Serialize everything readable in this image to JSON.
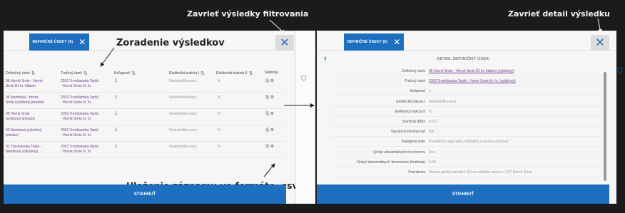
{
  "annotations": {
    "close_filter": "Zavrieť výsledky filtrovania",
    "close_detail": "Zavrieť detail výsledku",
    "sorting": "Zoradenie výsledkov",
    "save_csv": "Uloženie záznamu vo formáte .csv",
    "bottom_note": ""
  },
  "left_panel": {
    "tab_label": "DEFINIČNÉ ÚSEKY (6)",
    "close_symbol": "✕",
    "columns": [
      "Definičný úsek",
      "Traťový úsek",
      "Koľajnosť",
      "Elektrická trakcia I",
      "Elektrická trakcia II",
      "Nástroje"
    ],
    "rows": [
      {
        "def": "06 Horné Srnie - Horné\nSrnie 81 hr. štátom",
        "trat": "2303 Trenčianska Teplá\n- Horné Srnie št. hr.",
        "kol": "1",
        "et1": "Neelektrifikovaná",
        "et2": "N"
      },
      {
        "def": "04 Nemšová - Horné\nSrnie (vylúčený priestor)",
        "trat": "2303 Trenčianska Teplá\n- Horné Srnie št. hr.",
        "kol": "1",
        "et1": "Neelektrifikovaná",
        "et2": "N"
      },
      {
        "def": "05 Horné Srnie\n(vylúčený priestor)",
        "trat": "2303 Trenčianska Teplá\n- Horné Srnie št. hr.",
        "kol": "1",
        "et1": "Neelektrifikovaná",
        "et2": "N"
      },
      {
        "def": "02 Nemšová (vylúčený\npriestor)",
        "trat": "2303 Trenčianska Teplá\n- Horné Srnie št. hr.",
        "kol": "1",
        "et1": "Neelektrifikovaná",
        "et2": "N"
      },
      {
        "def": "01 Trenčianska Teplá -\nNemšová (vylúčený)",
        "trat": "2303 Trenčianska Teplá\n- Horné Srnie št. hr.",
        "kol": "1",
        "et1": "Neelektrifikovaná",
        "et2": "N"
      }
    ],
    "submit_label": "STIAHNUŤ"
  },
  "right_panel": {
    "tab_label": "DEFINIČNÉ ÚSEKY (6)",
    "close_symbol": "✕",
    "back_symbol": "‹",
    "detail_title": "DETAIL DEFINIČNÝ ÚSEK",
    "fields": [
      {
        "label": "Definičný úsek",
        "value": "06 Horné Srnie - Horné Srnie 81 hr. štátom (vylúčený)",
        "link": true
      },
      {
        "label": "Traťový úsek",
        "value": "2303 Trenčianska Teplá - Horné Srnie št. hr. (vylúčený)",
        "link": true
      },
      {
        "label": "Koľajnosť",
        "value": "1",
        "link": false
      },
      {
        "label": "Elektrická trakcia I",
        "value": "Neelektrifikovaná",
        "link": false
      },
      {
        "label": "Elektrická trakcia II",
        "value": "N",
        "link": false
      },
      {
        "label": "Staničná dĺžka",
        "value": "4.912",
        "link": false
      },
      {
        "label": "Vysokorýchlostná trať",
        "value": "Nie",
        "link": false
      },
      {
        "label": "Kategória trate",
        "value": "Pravidelná regionálna nákladná a osobná doprava",
        "link": false
      },
      {
        "label": "Výskyt abnormálnych fenomenov",
        "value": "Áno",
        "link": false
      },
      {
        "label": "Výskyt abnormálnych fenomenov (hodnota)",
        "value": "0.00",
        "link": false
      },
      {
        "label": "Poznámka",
        "value": "Zmena polohy začiatku DÚ na základe zmeny v ZTP Horné Srnie",
        "link": false
      }
    ],
    "submit_label": "STIAHNUŤ"
  },
  "icons": {
    "filter": "filter-icon",
    "sort": "sort-icon",
    "save": "save-icon",
    "settings": "gear-icon"
  },
  "colors": {
    "accent": "#1f6fc1",
    "link": "#6a3d8a"
  }
}
